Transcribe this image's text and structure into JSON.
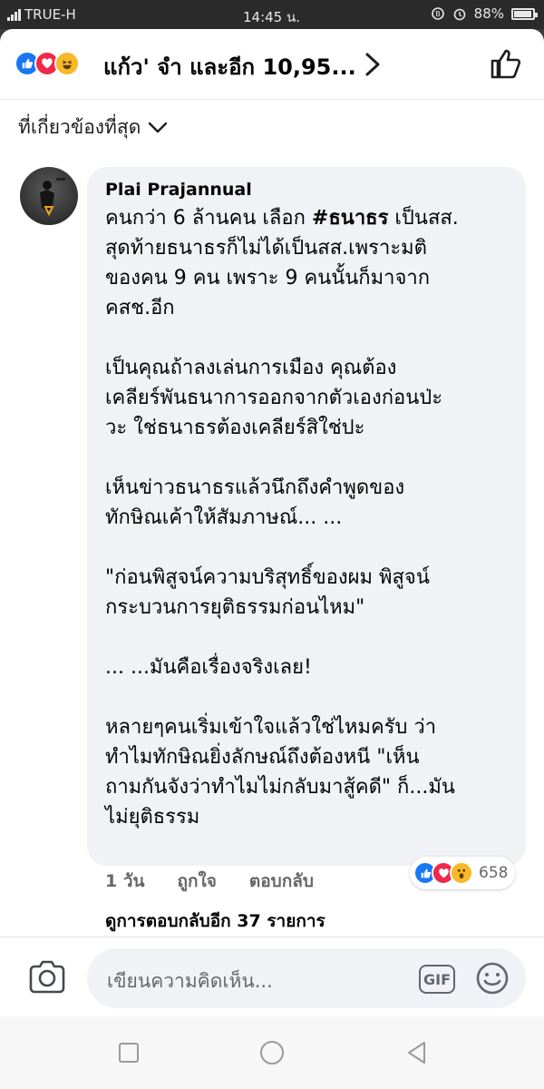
{
  "status_bar": {
    "carrier": "TRUE-H",
    "time": "14:45 น.",
    "battery": "88%"
  },
  "header": {
    "reaction_icons": [
      "like-icon",
      "love-icon",
      "haha-icon"
    ],
    "summary": "แก้ว' จำ และอีก 10,95..."
  },
  "sort": {
    "label": "ที่เกี่ยวข้องที่สุด"
  },
  "comment": {
    "author": "Plai Prajannual",
    "paragraphs": [
      [
        "คนกว่า 6 ล้านคน เลือก ",
        "#ธนาธร",
        " เป็นสส.",
        "สุดท้ายธนาธรก็ไม่ได้เป็นสส.เพราะมติ",
        "ของคน 9 คน เพราะ 9 คนนั้นก็มาจาก",
        "คสช.อีก"
      ],
      [
        "เป็นคุณถ้าลงเล่นการเมือง คุณต้อง",
        "เคลียร์พันธนาการออกจากตัวเองก่อนป่ะ",
        "วะ ใช่ธนาธรต้องเคลียร์สิใช่ปะ"
      ],
      [
        "เห็นข่าวธนาธรแล้วนึกถึงคำพูดของ",
        "ทักษิณเค้าให้สัมภาษณ์... ..."
      ],
      [
        "\"ก่อนพิสูจน์ความบริสุทธิ์ของผม พิสูจน์",
        "กระบวนการยุติธรรมก่อนไหม\""
      ],
      [
        "... ...มันคือเรื่องจริงเลย!"
      ],
      [
        "หลายๆคนเริ่มเข้าใจแล้วใช่ไหมครับ ว่า",
        "ทำไมทักษิณยิ่งลักษณ์ถึงต้องหนี \"เห็น",
        "ถามกันจังว่าทำไมไม่กลับมาสู้คดี\" ก็...มัน",
        "ไม่ยุติธรรม"
      ]
    ],
    "time": "1 วัน",
    "like_label": "ถูกใจ",
    "reply_label": "ตอบกลับ",
    "reaction_icons": [
      "like-icon",
      "love-icon",
      "wow-icon"
    ],
    "reaction_count": "658",
    "view_replies": "ดูการตอบกลับอีก 37 รายการ"
  },
  "composer": {
    "placeholder": "เขียนความคิดเห็น...",
    "gif_label": "GIF"
  },
  "colors": {
    "like": "#1877f2",
    "love": "#f02849",
    "haha": "#f7b928",
    "bubble": "#f0f2f5"
  }
}
